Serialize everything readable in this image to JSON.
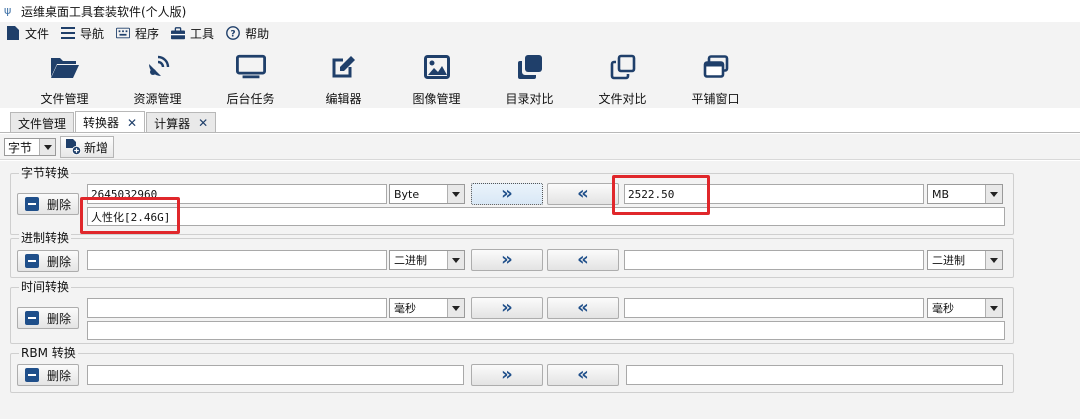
{
  "window": {
    "title": "运维桌面工具套装软件(个人版)"
  },
  "menu": [
    {
      "label": "文件",
      "icon": "file-icon"
    },
    {
      "label": "导航",
      "icon": "hamburger-icon"
    },
    {
      "label": "程序",
      "icon": "keyboard-icon"
    },
    {
      "label": "工具",
      "icon": "toolbox-icon"
    },
    {
      "label": "帮助",
      "icon": "help-icon"
    }
  ],
  "toolbar": [
    {
      "label": "文件管理",
      "icon": "folder-open-icon"
    },
    {
      "label": "资源管理",
      "icon": "satellite-icon"
    },
    {
      "label": "后台任务",
      "icon": "monitor-icon"
    },
    {
      "label": "编辑器",
      "icon": "edit-icon"
    },
    {
      "label": "图像管理",
      "icon": "image-icon"
    },
    {
      "label": "目录对比",
      "icon": "clone-icon"
    },
    {
      "label": "文件对比",
      "icon": "copy-icon"
    },
    {
      "label": "平铺窗口",
      "icon": "windows-icon"
    }
  ],
  "tabs": [
    {
      "label": "文件管理",
      "closable": false
    },
    {
      "label": "转换器",
      "closable": true,
      "active": true
    },
    {
      "label": "计算器",
      "closable": true
    }
  ],
  "subbar": {
    "unit_select": "字节",
    "add_label": "新增"
  },
  "groups": {
    "byte": {
      "title": "字节转换",
      "delete_label": "删除",
      "left_value": "2645032960",
      "left_unit": "Byte",
      "right_value": "2522.50",
      "right_unit": "MB",
      "result": "人性化[2.46G]"
    },
    "radix": {
      "title": "进制转换",
      "delete_label": "删除",
      "left_value": "",
      "left_unit": "二进制",
      "right_value": "",
      "right_unit": "二进制"
    },
    "time": {
      "title": "时间转换",
      "delete_label": "删除",
      "left_value": "",
      "left_unit": "毫秒",
      "right_value": "",
      "right_unit": "毫秒",
      "result": ""
    },
    "rbm": {
      "title": "RBM 转换",
      "delete_label": "删除",
      "left_value": "",
      "right_value": ""
    }
  },
  "buttons": {
    "forward": "»",
    "backward": "«"
  },
  "colors": {
    "accent": "#1f4f8a",
    "highlight": "#e0272b"
  }
}
